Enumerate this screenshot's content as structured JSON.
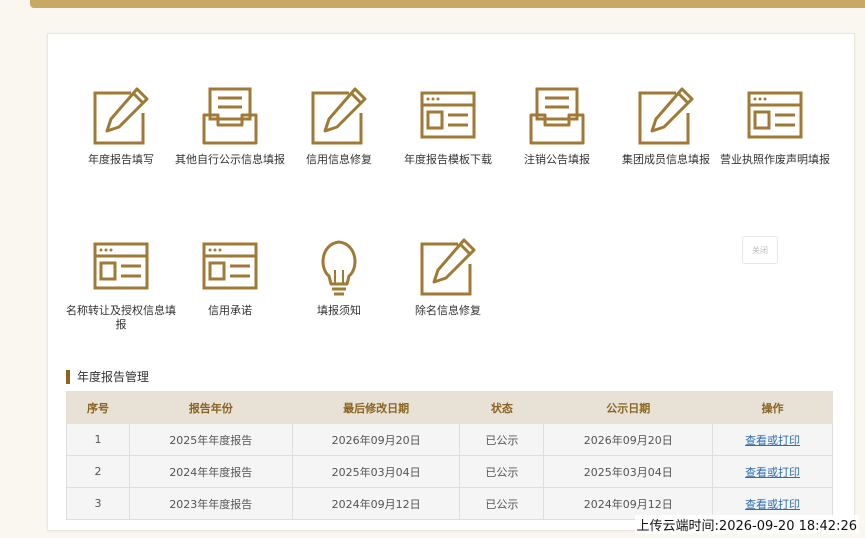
{
  "tiles": [
    {
      "label": "年度报告填写",
      "icon": "pencil-icon"
    },
    {
      "label": "其他自行公示信息填报",
      "icon": "inbox-icon"
    },
    {
      "label": "信用信息修复",
      "icon": "pencil-icon"
    },
    {
      "label": "年度报告模板下载",
      "icon": "form-icon"
    },
    {
      "label": "注销公告填报",
      "icon": "inbox-icon"
    },
    {
      "label": "集团成员信息填报",
      "icon": "pencil-icon"
    },
    {
      "label": "营业执照作废声明填报",
      "icon": "form-icon"
    },
    {
      "label": "名称转让及授权信息填报",
      "icon": "form-icon"
    },
    {
      "label": "信用承诺",
      "icon": "form-icon"
    },
    {
      "label": "填报须知",
      "icon": "lightbulb-icon"
    },
    {
      "label": "除名信息修复",
      "icon": "pencil-icon"
    }
  ],
  "close_label": "关闭",
  "section_title": "年度报告管理",
  "table": {
    "headers": [
      "序号",
      "报告年份",
      "最后修改日期",
      "状态",
      "公示日期",
      "操作"
    ],
    "rows": [
      [
        "1",
        "2025年年度报告",
        "2026年09月20日",
        "已公示",
        "2026年09月20日",
        "查看或打印"
      ],
      [
        "2",
        "2024年年度报告",
        "2025年03月04日",
        "已公示",
        "2025年03月04日",
        "查看或打印"
      ],
      [
        "3",
        "2023年年度报告",
        "2024年09月12日",
        "已公示",
        "2024年09月12日",
        "查看或打印"
      ]
    ]
  },
  "timestamp": "上传云端时间:2026-09-20 18:42:26",
  "colors": {
    "accent": "#a07a35",
    "header_bg": "#e8e1d5",
    "link": "#2e6db4",
    "topbar": "#c9a865"
  }
}
